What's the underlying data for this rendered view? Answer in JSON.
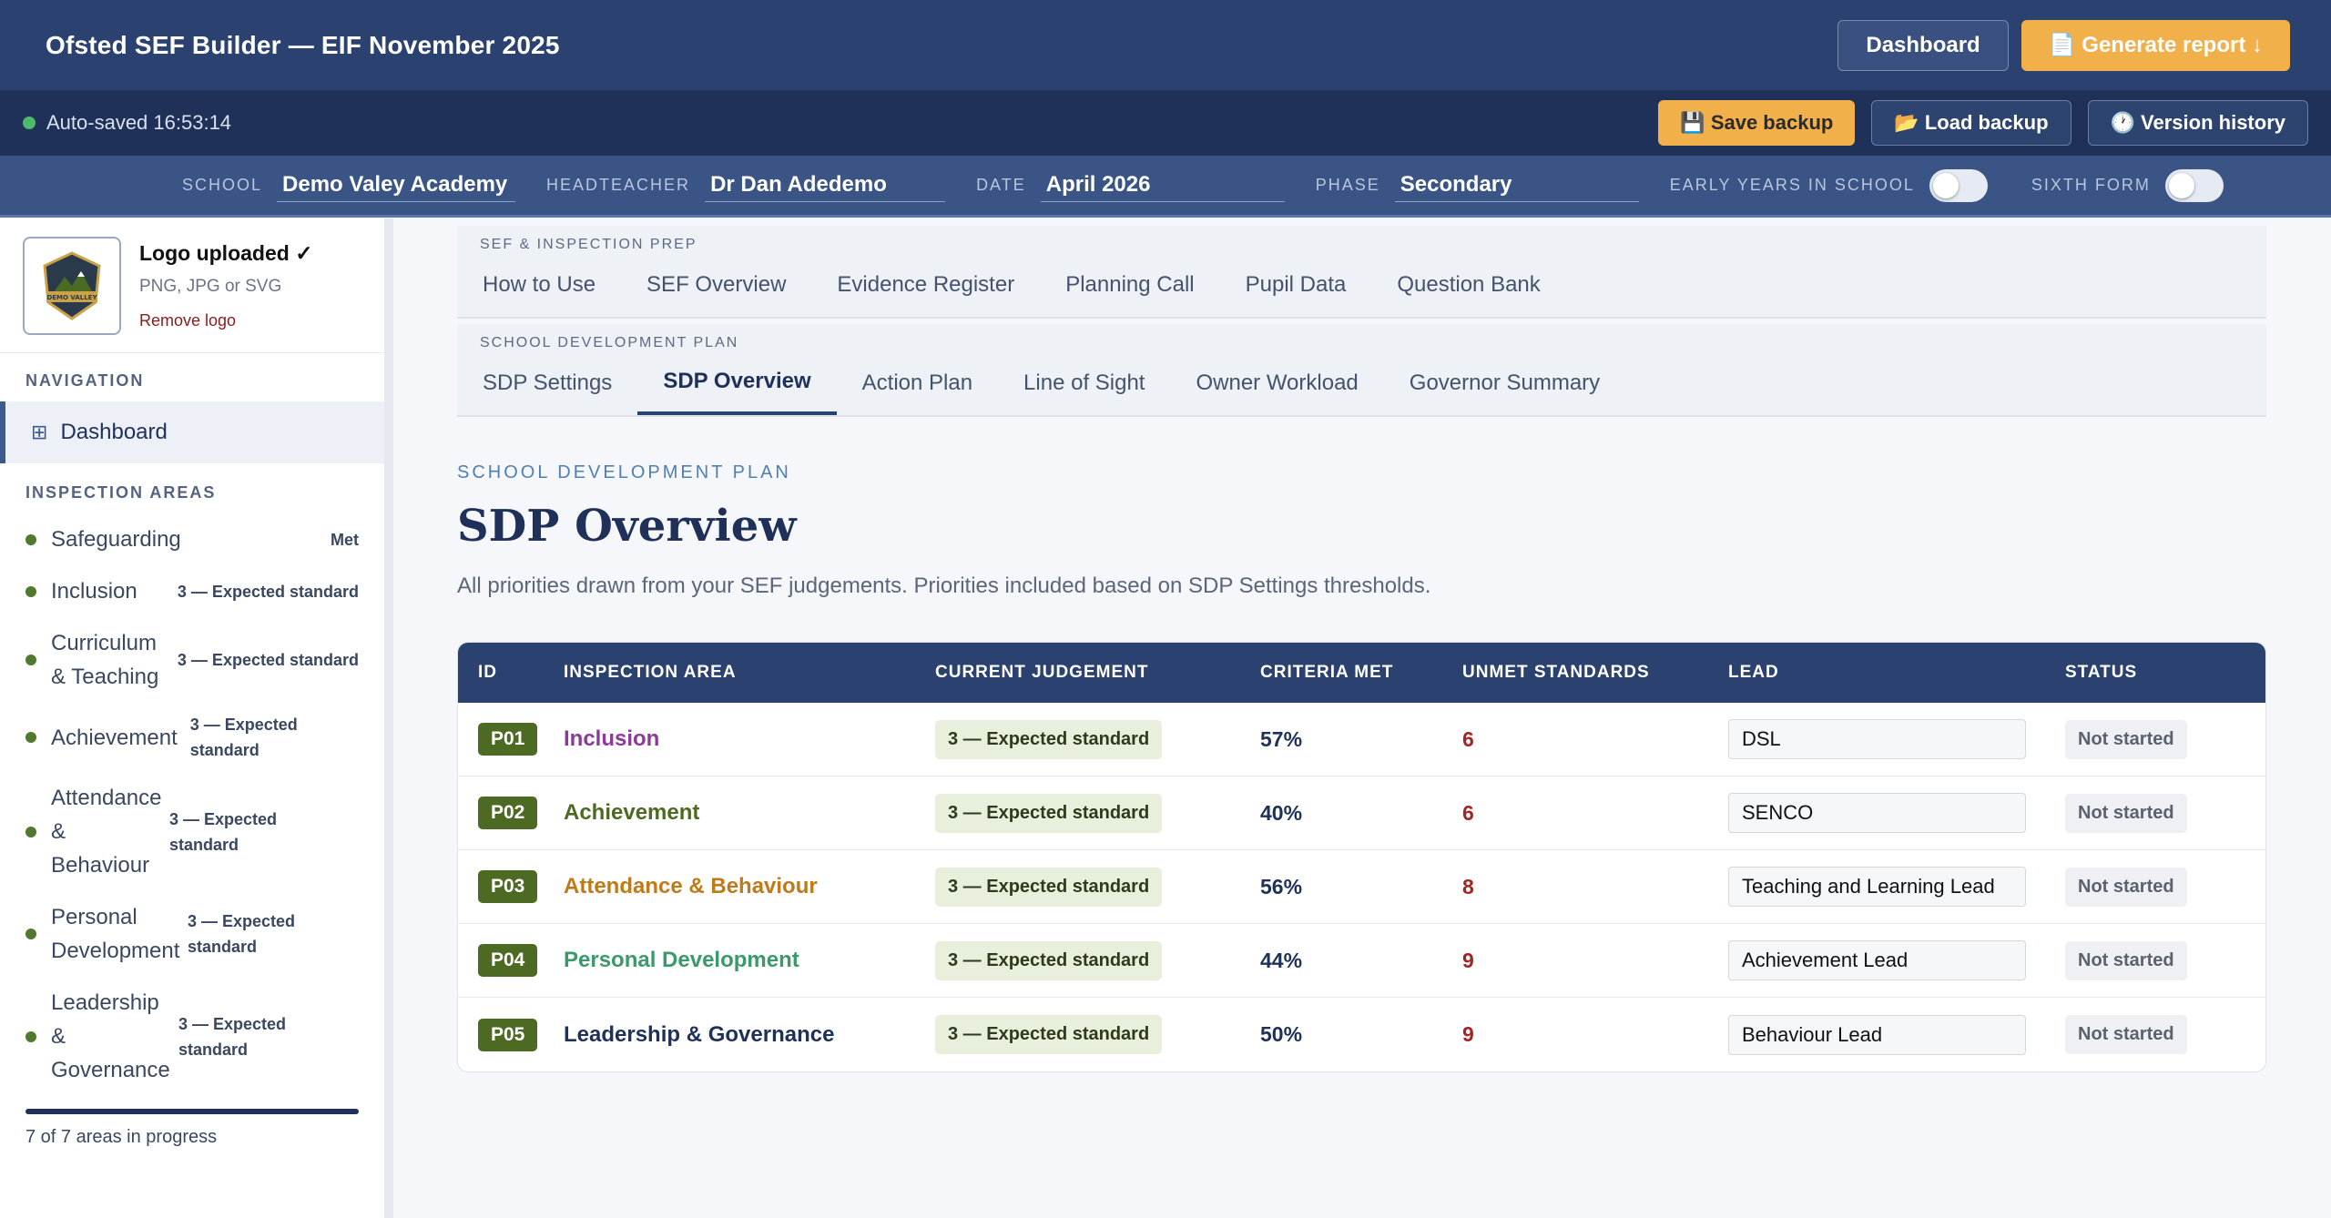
{
  "header": {
    "title": "Ofsted SEF Builder — EIF November 2025",
    "dashboard_label": "Dashboard",
    "generate_label": "📄 Generate report ↓"
  },
  "statusbar": {
    "autosave": "Auto-saved 16:53:14",
    "save_backup": "💾 Save backup",
    "load_backup": "📂 Load backup",
    "version_history": "🕐 Version history"
  },
  "meta": {
    "school_label": "SCHOOL",
    "school_value": "Demo Valey Academy",
    "headteacher_label": "HEADTEACHER",
    "headteacher_value": "Dr Dan Adedemo",
    "date_label": "DATE",
    "date_value": "April 2026",
    "phase_label": "PHASE",
    "phase_value": "Secondary",
    "early_years_label": "EARLY YEARS IN SCHOOL",
    "sixth_form_label": "SIXTH FORM"
  },
  "sidebar": {
    "logo_status": "Logo uploaded ✓",
    "logo_formats": "PNG, JPG or SVG",
    "remove_logo": "Remove logo",
    "logo_text": "DEMO VALLEY",
    "nav_heading": "NAVIGATION",
    "dashboard": "Dashboard",
    "areas_heading": "INSPECTION AREAS",
    "areas": [
      {
        "name": "Safeguarding",
        "status": "Met"
      },
      {
        "name": "Inclusion",
        "status": "3 — Expected standard"
      },
      {
        "name": "Curriculum & Teaching",
        "status": "3 — Expected standard"
      },
      {
        "name": "Achievement",
        "status": "3 — Expected standard"
      },
      {
        "name": "Attendance & Behaviour",
        "status": "3 — Expected standard"
      },
      {
        "name": "Personal Development",
        "status": "3 — Expected standard"
      },
      {
        "name": "Leadership & Governance",
        "status": "3 — Expected standard"
      }
    ],
    "progress_text": "7 of 7 areas in progress"
  },
  "tabs": {
    "prep_label": "SEF & INSPECTION PREP",
    "prep": [
      "How to Use",
      "SEF Overview",
      "Evidence Register",
      "Planning Call",
      "Pupil Data",
      "Question Bank"
    ],
    "sdp_label": "SCHOOL DEVELOPMENT PLAN",
    "sdp": [
      "SDP Settings",
      "SDP Overview",
      "Action Plan",
      "Line of Sight",
      "Owner Workload",
      "Governor Summary"
    ]
  },
  "page": {
    "eyebrow": "SCHOOL DEVELOPMENT PLAN",
    "title": "SDP Overview",
    "description": "All priorities drawn from your SEF judgements. Priorities included based on SDP Settings thresholds."
  },
  "table": {
    "headers": [
      "ID",
      "INSPECTION AREA",
      "CURRENT JUDGEMENT",
      "CRITERIA MET",
      "UNMET STANDARDS",
      "LEAD",
      "STATUS"
    ],
    "rows": [
      {
        "id": "P01",
        "area": "Inclusion",
        "color": "#8b3a9a",
        "judgement": "3 — Expected standard",
        "criteria": "57%",
        "unmet": "6",
        "lead": "DSL",
        "status": "Not started"
      },
      {
        "id": "P02",
        "area": "Achievement",
        "color": "#4d6a22",
        "judgement": "3 — Expected standard",
        "criteria": "40%",
        "unmet": "6",
        "lead": "SENCO",
        "status": "Not started"
      },
      {
        "id": "P03",
        "area": "Attendance & Behaviour",
        "color": "#c07a1a",
        "judgement": "3 — Expected standard",
        "criteria": "56%",
        "unmet": "8",
        "lead": "Teaching and Learning Lead",
        "status": "Not started"
      },
      {
        "id": "P04",
        "area": "Personal Development",
        "color": "#3a9a6a",
        "judgement": "3 — Expected standard",
        "criteria": "44%",
        "unmet": "9",
        "lead": "Achievement Lead",
        "status": "Not started"
      },
      {
        "id": "P05",
        "area": "Leadership & Governance",
        "color": "#1f3158",
        "judgement": "3 — Expected standard",
        "criteria": "50%",
        "unmet": "9",
        "lead": "Behaviour Lead",
        "status": "Not started"
      }
    ]
  }
}
